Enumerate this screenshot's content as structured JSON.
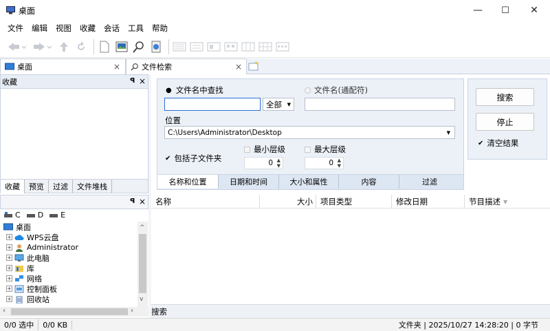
{
  "window": {
    "title": "桌面",
    "min": "—",
    "max": "☐",
    "close": "✕"
  },
  "menu": [
    "文件",
    "编辑",
    "视图",
    "收藏",
    "会话",
    "工具",
    "帮助"
  ],
  "left_tab": {
    "label": "桌面",
    "close": "×"
  },
  "favorites": {
    "title": "收藏",
    "pin": "ᵖ",
    "close": "×"
  },
  "left_tabs": [
    "收藏",
    "预览",
    "过滤",
    "文件堆栈"
  ],
  "tree_header": {
    "pin": "ᵖ",
    "close": "×"
  },
  "drives": [
    "C",
    "D",
    "E"
  ],
  "tree": {
    "root": "桌面",
    "items": [
      "WPS云盘",
      "Administrator",
      "此电脑",
      "库",
      "网络",
      "控制面板",
      "回收站"
    ]
  },
  "search_tab": {
    "label": "文件检索",
    "close": "×"
  },
  "search": {
    "radio1": "文件名中查找",
    "radio2": "文件名(通配符)",
    "name_value": "",
    "scope": "全部",
    "wildcard_value": "",
    "location_label": "位置",
    "location_value": "C:\\Users\\Administrator\\Desktop",
    "include_sub": "包括子文件夹",
    "min_level": "最小层级",
    "max_level": "最大层级",
    "min_value": "0",
    "max_value": "0",
    "search_btn": "搜索",
    "stop_btn": "停止",
    "clear": "清空结果"
  },
  "sub_tabs": [
    "名称和位置",
    "日期和时间",
    "大小和属性",
    "内容",
    "过滤"
  ],
  "columns": [
    "名称",
    "大小",
    "项目类型",
    "修改日期",
    "节目描述"
  ],
  "results_footer": "搜索",
  "status": {
    "selected": "0/0 选中",
    "size": "0/0 KB",
    "right": "文件夹 | 2025/10/27 14:28:20 | 0 字节"
  }
}
